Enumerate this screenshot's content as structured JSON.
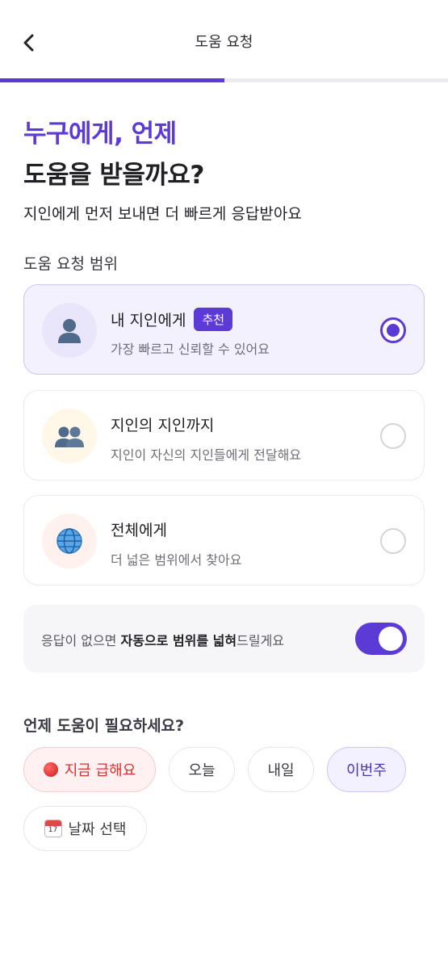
{
  "header": {
    "title": "도움 요청"
  },
  "progress": {
    "fraction": 0.5
  },
  "headline": {
    "line1": "누구에게, 언제",
    "line2": "도움을 받을까요?"
  },
  "subtitle": "지인에게 먼저 보내면 더 빠르게 응답받아요",
  "scope": {
    "label": "도움 요청 범위",
    "options": [
      {
        "title": "내 지인에게",
        "badge": "추천",
        "desc": "가장 빠르고 신뢰할 수 있어요",
        "icon": "person-icon",
        "selected": true
      },
      {
        "title": "지인의 지인까지",
        "desc": "지인이 자신의 지인들에게 전달해요",
        "icon": "people-icon",
        "selected": false
      },
      {
        "title": "전체에게",
        "desc": "더 넓은 범위에서 찾아요",
        "icon": "globe-icon",
        "selected": false
      }
    ]
  },
  "auto_expand": {
    "text_pre": "응답이 없으면 ",
    "text_bold1": "자동으로 범위를 넓혀",
    "text_post": "드릴게요",
    "enabled": true
  },
  "when": {
    "label": "언제 도움이 필요하세요?",
    "chips": [
      {
        "label": "지금 급해요",
        "icon": "red-circle-icon",
        "style": "urgent"
      },
      {
        "label": "오늘"
      },
      {
        "label": "내일"
      },
      {
        "label": "이번주",
        "style": "active"
      },
      {
        "label": "날짜 선택",
        "icon": "calendar-icon",
        "icon_text": "17"
      }
    ]
  },
  "colors": {
    "accent": "#5b3ad6",
    "urgent": "#d8322e"
  }
}
